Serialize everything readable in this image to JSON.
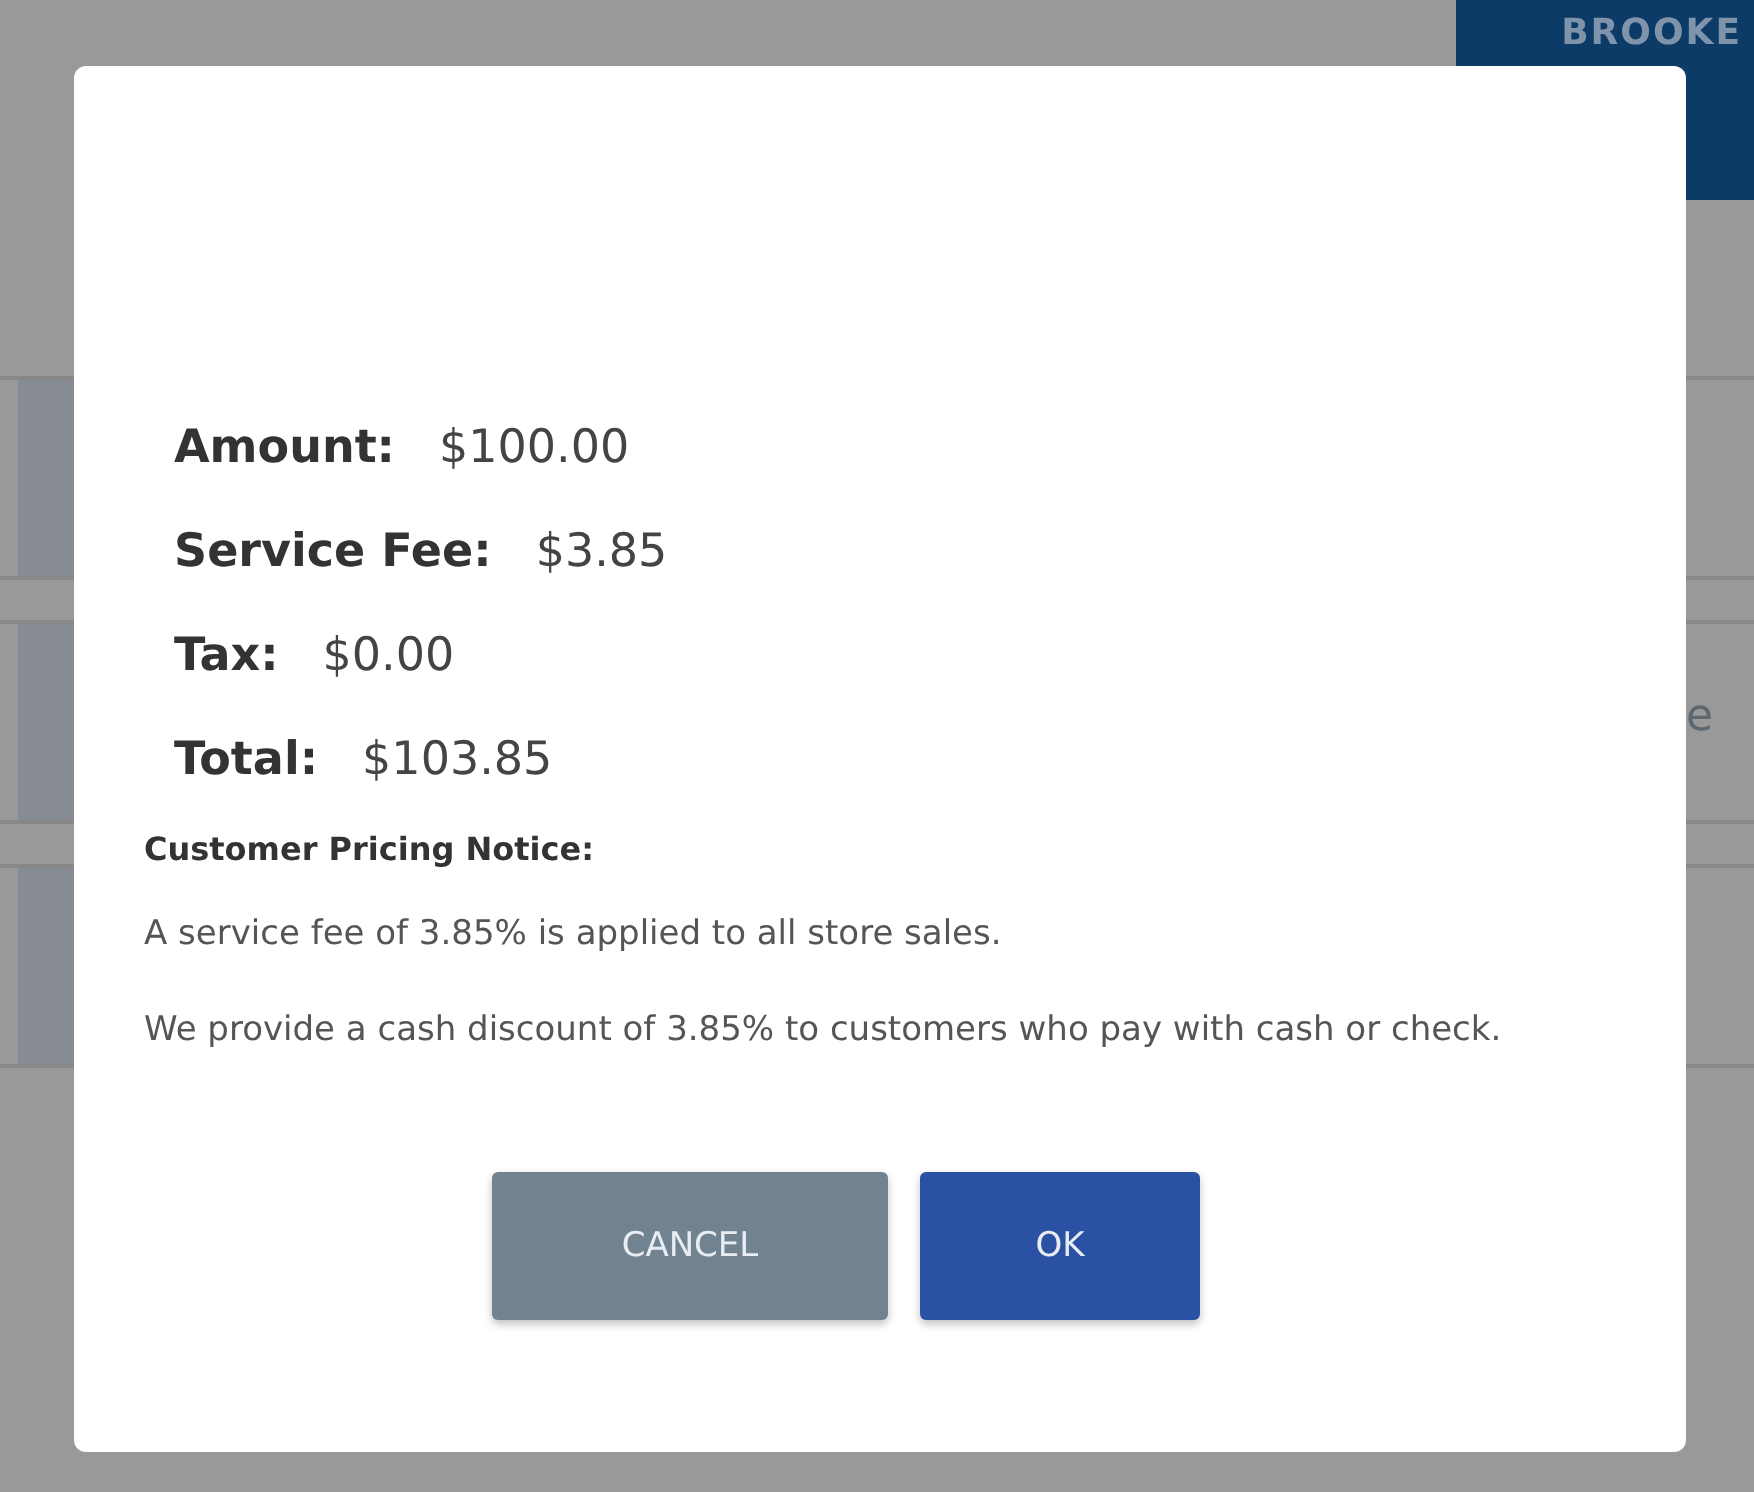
{
  "background": {
    "header_button": "BROOKE",
    "rows": [
      {
        "kind": "card"
      },
      {
        "kind": "card",
        "text": "e"
      },
      {
        "kind": "card"
      }
    ]
  },
  "dialog": {
    "summary": [
      {
        "label": "Amount:",
        "value": "$100.00"
      },
      {
        "label": "Service Fee:",
        "value": "$3.85"
      },
      {
        "label": "Tax:",
        "value": "$0.00"
      },
      {
        "label": "Total:",
        "value": "$103.85"
      }
    ],
    "notice_title": "Customer Pricing Notice:",
    "notice_paragraphs": [
      "A service fee of 3.85% is applied to all store sales.",
      "We provide a cash discount of 3.85% to customers who pay with cash or check."
    ],
    "buttons": [
      {
        "label": "CANCEL",
        "kind": "secondary"
      },
      {
        "label": "OK",
        "kind": "primary"
      }
    ]
  }
}
